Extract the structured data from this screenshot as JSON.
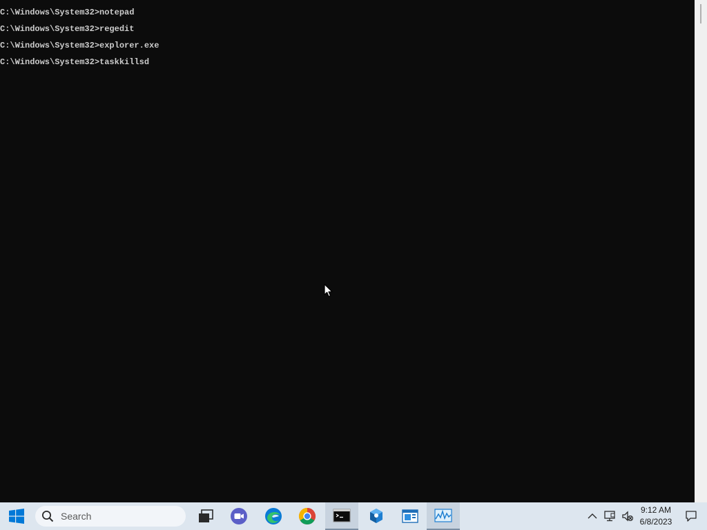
{
  "console": {
    "lines": [
      "C:\\Windows\\System32>notepad",
      "C:\\Windows\\System32>regedit",
      "C:\\Windows\\System32>explorer.exe",
      "C:\\Windows\\System32>taskkillsd"
    ],
    "background": "#0c0c0c",
    "text_color": "#cccccc"
  },
  "taskbar": {
    "search": {
      "placeholder": "Search"
    },
    "pinned": [
      {
        "name": "task-view-icon"
      },
      {
        "name": "teams-meet-icon"
      },
      {
        "name": "edge-icon"
      },
      {
        "name": "chrome-icon"
      },
      {
        "name": "command-prompt-icon",
        "active": true
      },
      {
        "name": "settings-cube-icon"
      },
      {
        "name": "window-app-icon"
      },
      {
        "name": "performance-monitor-icon"
      }
    ],
    "tray": {
      "icons": [
        "show-hidden-icons-icon",
        "network-icon",
        "volume-muted-icon"
      ],
      "time": "9:12 AM",
      "date": "6/8/2023",
      "notification_icon": "action-center-icon"
    }
  }
}
